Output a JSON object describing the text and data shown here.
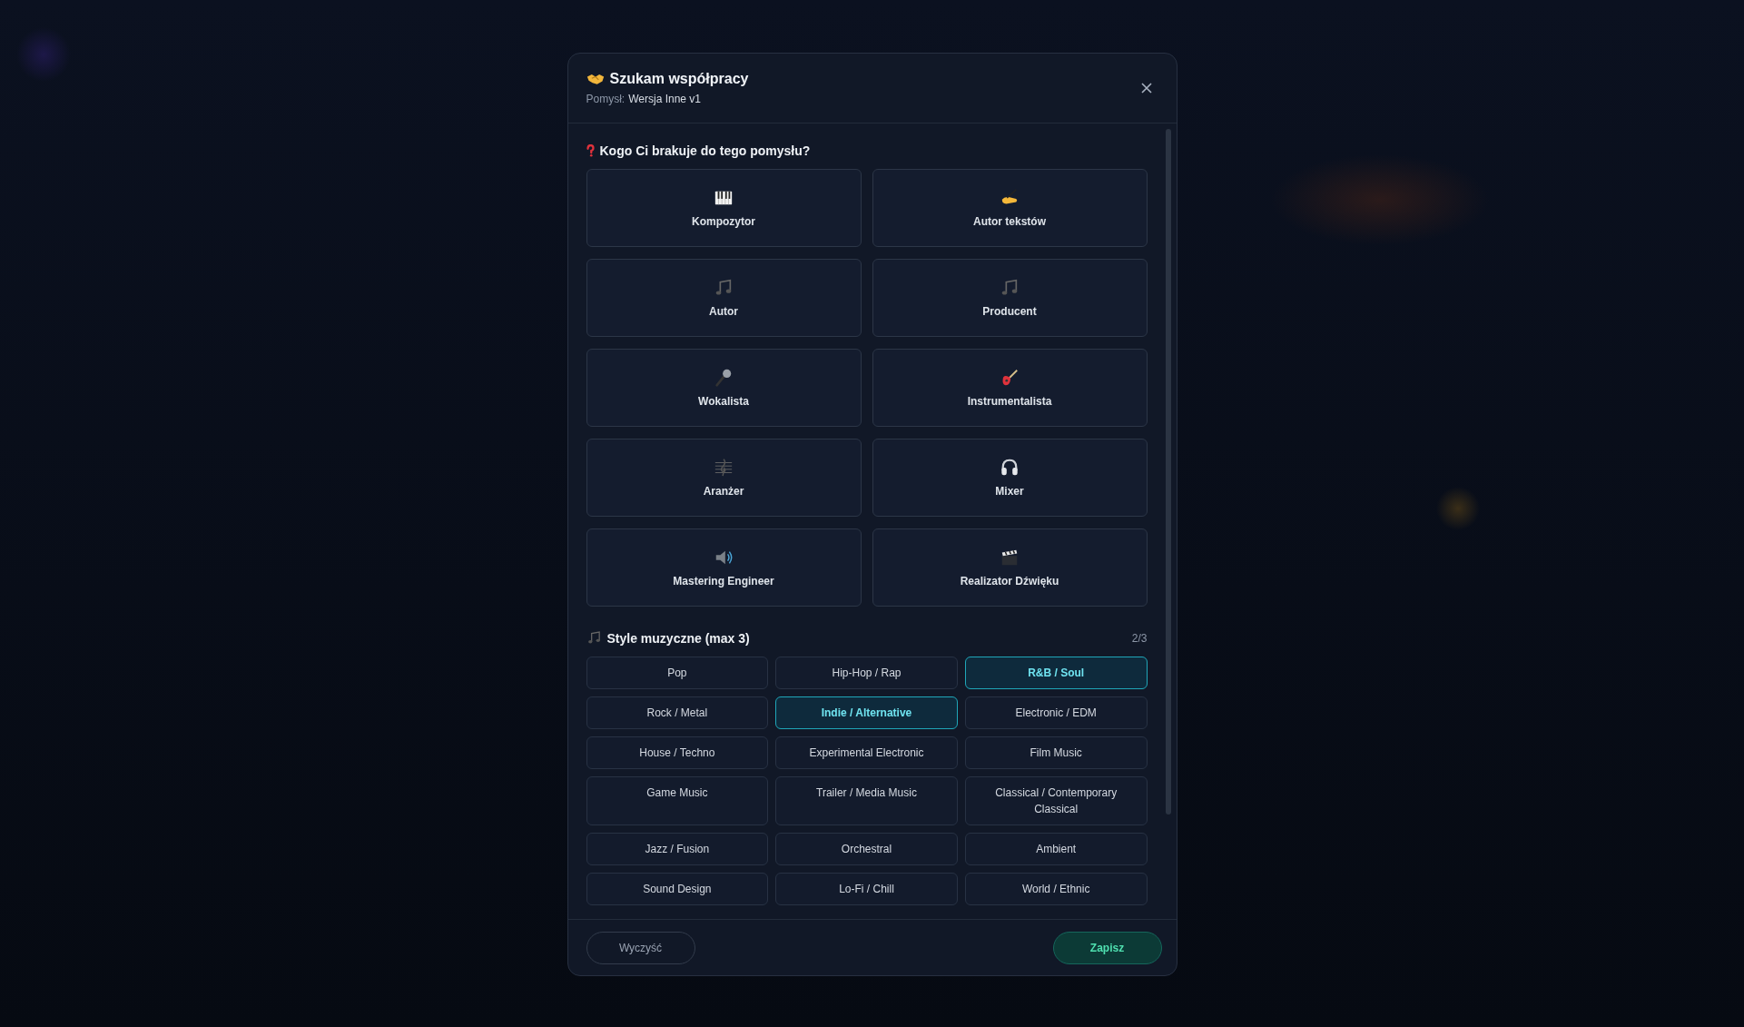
{
  "dialog": {
    "title": "Szukam współpracy",
    "subtitle_label": "Pomysł:",
    "subtitle_value": "Wersja Inne v1"
  },
  "roles_section": {
    "title": "Kogo Ci brakuje do tego pomysłu?"
  },
  "roles": [
    {
      "label": "Kompozytor",
      "kind": "piano"
    },
    {
      "label": "Autor tekstów",
      "kind": "writing"
    },
    {
      "label": "Autor",
      "kind": "notes"
    },
    {
      "label": "Producent",
      "kind": "notes"
    },
    {
      "label": "Wokalista",
      "kind": "microphone"
    },
    {
      "label": "Instrumentalista",
      "kind": "guitar"
    },
    {
      "label": "Aranżer",
      "kind": "score"
    },
    {
      "label": "Mixer",
      "kind": "headphones"
    },
    {
      "label": "Mastering Engineer",
      "kind": "speaker"
    },
    {
      "label": "Realizator Dźwięku",
      "kind": "clapper"
    }
  ],
  "styles_section": {
    "title": "Style muzyczne (max 3)",
    "count": "2/3"
  },
  "styles": [
    {
      "label": "Pop",
      "selected": false
    },
    {
      "label": "Hip-Hop / Rap",
      "selected": false
    },
    {
      "label": "R&B / Soul",
      "selected": true
    },
    {
      "label": "Rock / Metal",
      "selected": false
    },
    {
      "label": "Indie / Alternative",
      "selected": true
    },
    {
      "label": "Electronic / EDM",
      "selected": false
    },
    {
      "label": "House / Techno",
      "selected": false
    },
    {
      "label": "Experimental Electronic",
      "selected": false
    },
    {
      "label": "Film Music",
      "selected": false
    },
    {
      "label": "Game Music",
      "selected": false
    },
    {
      "label": "Trailer / Media Music",
      "selected": false
    },
    {
      "label": "Classical / Contemporary Classical",
      "selected": false
    },
    {
      "label": "Jazz / Fusion",
      "selected": false
    },
    {
      "label": "Orchestral",
      "selected": false
    },
    {
      "label": "Ambient",
      "selected": false
    },
    {
      "label": "Sound Design",
      "selected": false
    },
    {
      "label": "Lo-Fi / Chill",
      "selected": false
    },
    {
      "label": "World / Ethnic",
      "selected": false
    }
  ],
  "footer": {
    "clear_button": "Wyczyść",
    "save_button": "Zapisz"
  }
}
